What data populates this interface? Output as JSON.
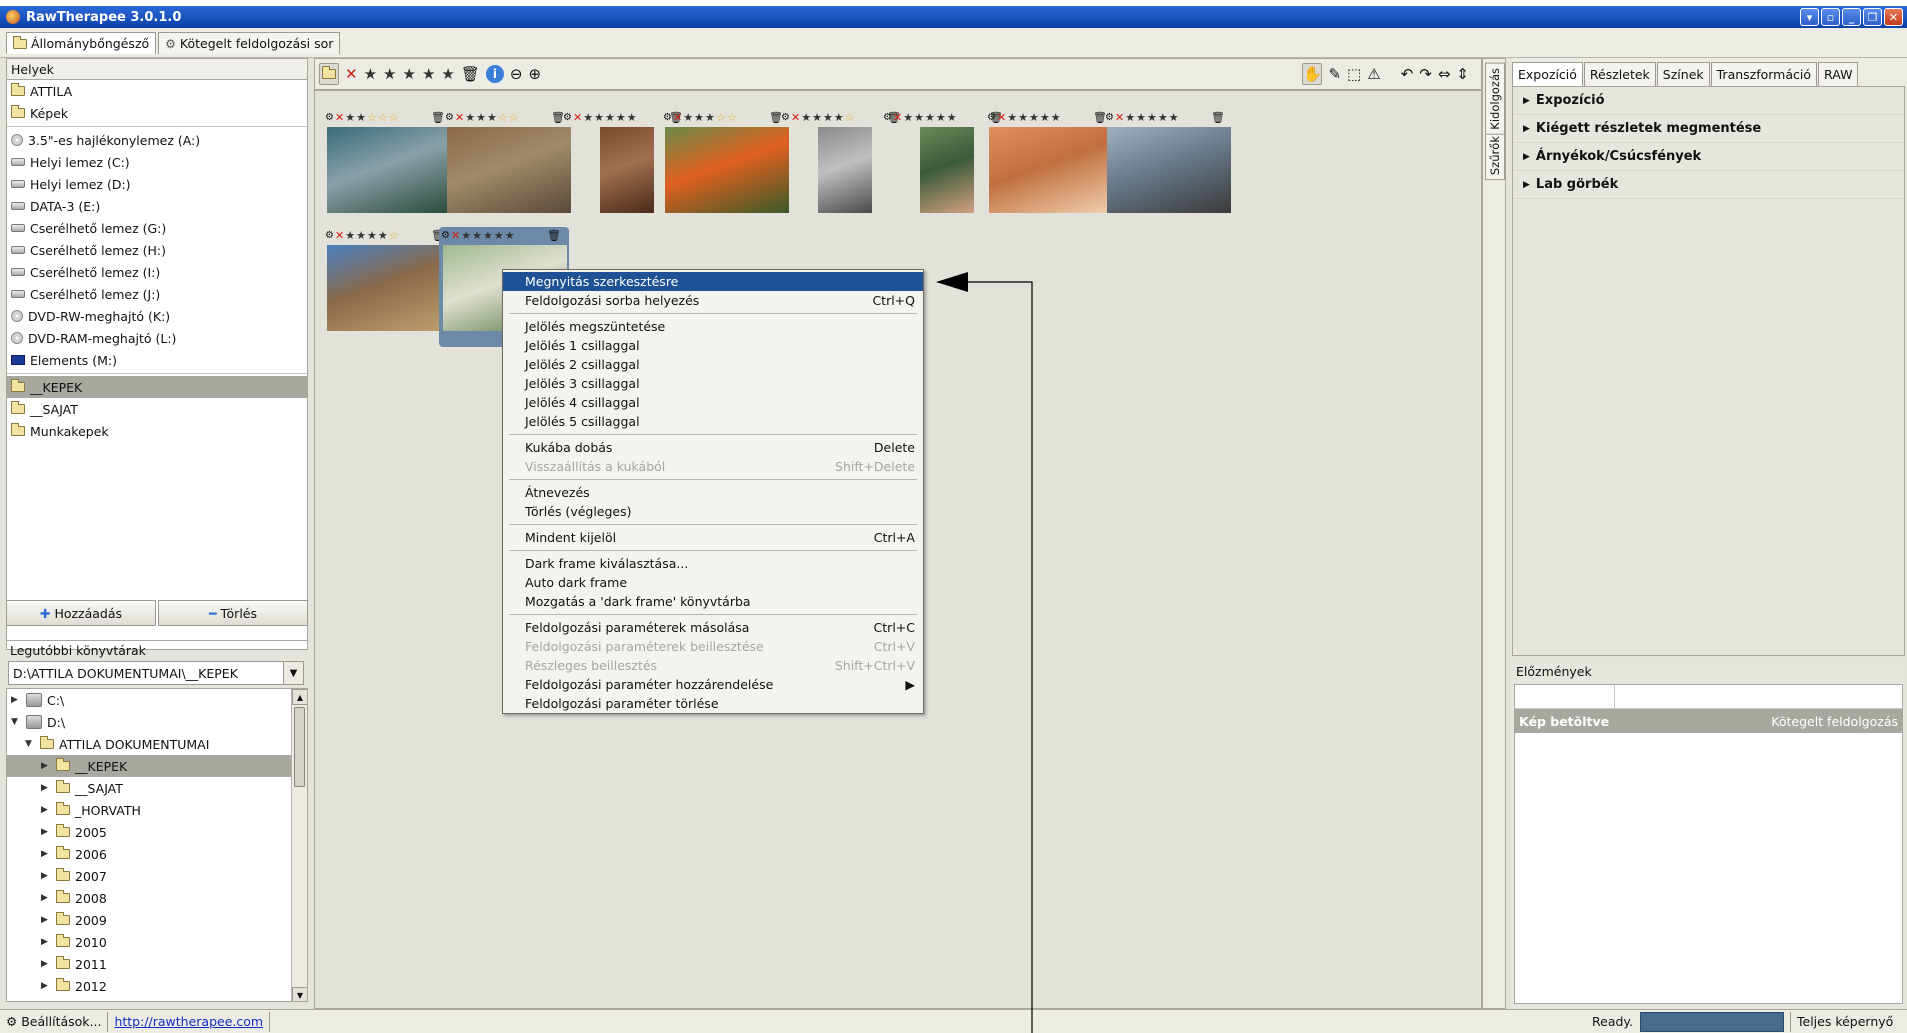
{
  "window": {
    "title": "RawTherapee 3.0.1.0"
  },
  "top_tabs": [
    "Állománybőngésző",
    "Kötegelt feldolgozási sor"
  ],
  "places": {
    "header": "Helyek",
    "items": [
      "ATTILA",
      "Képek"
    ],
    "drives": [
      "3.5\"-es hajlékonylemez (A:)",
      "Helyi lemez (C:)",
      "Helyi lemez (D:)",
      "DATA-3 (E:)",
      "Cserélhető lemez (G:)",
      "Cserélhető lemez (H:)",
      "Cserélhető lemez (I:)",
      "Cserélhető lemez (J:)",
      "DVD-RW-meghajtó (K:)",
      "DVD-RAM-meghajtó (L:)",
      "Elements (M:)"
    ],
    "bookmarks": [
      "__KEPEK",
      "__SAJAT",
      "Munkakepek"
    ]
  },
  "buttons": {
    "add": "Hozzáadás",
    "delete": "Törlés"
  },
  "recent": {
    "label": "Legutóbbi könyvtárak",
    "value": "D:\\ATTILA DOKUMENTUMAI\\__KEPEK"
  },
  "tree": {
    "nodes": [
      "C:\\",
      "D:\\",
      "ATTILA DOKUMENTUMAI",
      "__KEPEK",
      "__SAJAT",
      "_HORVATH",
      "2005",
      "2006",
      "2007",
      "2008",
      "2009",
      "2010",
      "2011",
      "2012"
    ]
  },
  "right_tabs": [
    "Expozíció",
    "Részletek",
    "Színek",
    "Transzformáció",
    "RAW"
  ],
  "sections": [
    "Expozíció",
    "Kiégett részletek megmentése",
    "Árnyékok/Csúcsfények",
    "Lab görbék"
  ],
  "vertical_tabs": [
    "Szűrők",
    "Kidolgozás"
  ],
  "history": {
    "label": "Előzmények",
    "row_left": "Kép betöltve",
    "row_right": "Kötegelt feldolgozás"
  },
  "status": {
    "settings": "Beállítások...",
    "link": "http://rawtherapee.com",
    "ready": "Ready.",
    "fullscreen": "Teljes képernyő"
  },
  "menu": [
    {
      "label": "Megnyitás szerkesztésre",
      "shortcut": "",
      "state": "highlight"
    },
    {
      "label": "Feldolgozási sorba helyezés",
      "shortcut": "Ctrl+Q",
      "state": "normal"
    },
    {
      "sep": true
    },
    {
      "label": "Jelölés megszüntetése",
      "shortcut": "",
      "state": "normal"
    },
    {
      "label": "Jelölés 1 csillaggal",
      "shortcut": "",
      "state": "normal"
    },
    {
      "label": "Jelölés 2 csillaggal",
      "shortcut": "",
      "state": "normal"
    },
    {
      "label": "Jelölés 3 csillaggal",
      "shortcut": "",
      "state": "normal"
    },
    {
      "label": "Jelölés 4 csillaggal",
      "shortcut": "",
      "state": "normal"
    },
    {
      "label": "Jelölés 5 csillaggal",
      "shortcut": "",
      "state": "normal"
    },
    {
      "sep": true
    },
    {
      "label": "Kukába dobás",
      "shortcut": "Delete",
      "state": "normal"
    },
    {
      "label": "Visszaállítás a kukából",
      "shortcut": "Shift+Delete",
      "state": "disabled"
    },
    {
      "sep": true
    },
    {
      "label": "Átnevezés",
      "shortcut": "",
      "state": "normal"
    },
    {
      "label": "Törlés (végleges)",
      "shortcut": "",
      "state": "normal"
    },
    {
      "sep": true
    },
    {
      "label": "Mindent kijelöl",
      "shortcut": "Ctrl+A",
      "state": "normal"
    },
    {
      "sep": true
    },
    {
      "label": "Dark frame kiválasztása...",
      "shortcut": "",
      "state": "normal"
    },
    {
      "label": "Auto dark frame",
      "shortcut": "",
      "state": "normal"
    },
    {
      "label": "Mozgatás a 'dark frame' könyvtárba",
      "shortcut": "",
      "state": "normal"
    },
    {
      "sep": true
    },
    {
      "label": "Feldolgozási paraméterek másolása",
      "shortcut": "Ctrl+C",
      "state": "normal"
    },
    {
      "label": "Feldolgozási paraméterek beillesztése",
      "shortcut": "Ctrl+V",
      "state": "disabled"
    },
    {
      "label": "Részleges beillesztés",
      "shortcut": "Shift+Ctrl+V",
      "state": "disabled"
    },
    {
      "label": "Feldolgozási paraméter hozzárendelése",
      "shortcut": "▶",
      "state": "normal"
    },
    {
      "label": "Feldolgozási paraméter törlése",
      "shortcut": "",
      "state": "normal"
    }
  ],
  "thumbnails": [
    {
      "name": "sea-lions",
      "colors": [
        "#3a6a7a",
        "#2a4a3a",
        "#8aa0a8"
      ]
    },
    {
      "name": "forest",
      "colors": [
        "#8a6a4a",
        "#5a4a3a",
        "#a08a6a"
      ]
    },
    {
      "name": "door",
      "colors": [
        "#7a4a2a",
        "#4a2a1a",
        "#a07050"
      ]
    },
    {
      "name": "butterfly",
      "colors": [
        "#6a8a4a",
        "#3a5a2a",
        "#e06020"
      ]
    },
    {
      "name": "bw-street",
      "colors": [
        "#8a8a8a",
        "#4a4a4a",
        "#c0c0c0"
      ]
    },
    {
      "name": "man-portrait",
      "colors": [
        "#6a8a5a",
        "#d0a080",
        "#3a5a3a"
      ]
    },
    {
      "name": "child-portrait",
      "colors": [
        "#e09060",
        "#f0d0b0",
        "#c07040"
      ]
    },
    {
      "name": "statue",
      "colors": [
        "#a0b0c0",
        "#3a3a3a",
        "#6a7a8a"
      ]
    },
    {
      "name": "cathedral",
      "colors": [
        "#4a80c0",
        "#c0a070",
        "#8a6a4a"
      ]
    },
    {
      "name": "flower",
      "colors": [
        "#a0b890",
        "#5a7a4a",
        "#e0e0d0"
      ]
    }
  ]
}
